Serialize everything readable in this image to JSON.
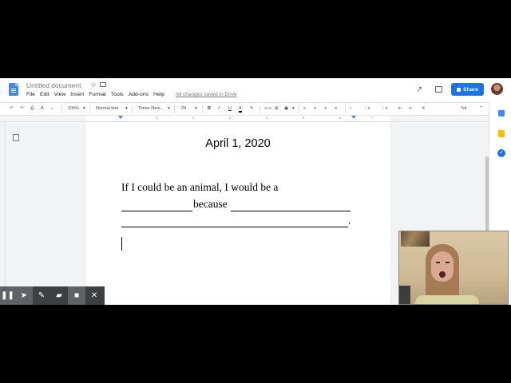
{
  "header": {
    "doc_title": "Untitled document",
    "menu": [
      "File",
      "Edit",
      "View",
      "Insert",
      "Format",
      "Tools",
      "Add-ons",
      "Help"
    ],
    "save_status": "All changes saved in Drive",
    "share_label": "Share"
  },
  "toolbar": {
    "zoom": "100%",
    "style": "Normal text",
    "font": "Times New...",
    "font_size": "24"
  },
  "ruler": {
    "numbers": [
      "1",
      "1",
      "2",
      "3",
      "4",
      "5",
      "6",
      "7"
    ]
  },
  "document": {
    "date": "April 1, 2020",
    "line1": "If I could be an animal, I would be a",
    "line2_word": "because",
    "line3_end": "."
  },
  "colors": {
    "share_blue": "#1a73e8",
    "annotation_bar": "#3c4043"
  }
}
